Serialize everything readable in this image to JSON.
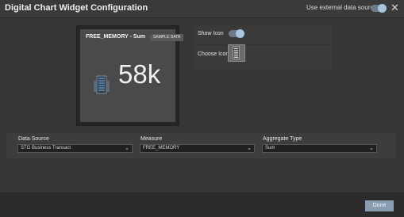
{
  "dialog": {
    "title": "Digital Chart Widget Configuration",
    "external_label": "Use external data sources"
  },
  "preview": {
    "title": "FREE_MEMORY - Sum",
    "badge": "SAMPLE DATA",
    "value": "58k"
  },
  "options": {
    "show_icon_label": "Show Icon",
    "choose_icon_label": "Choose Icon"
  },
  "fields": {
    "data_source": {
      "label": "Data Source",
      "value": "STG Business Transact"
    },
    "measure": {
      "label": "Measure",
      "value": "FREE_MEMORY"
    },
    "aggregate": {
      "label": "Aggregate Type",
      "value": "Sum"
    }
  },
  "footer": {
    "done_label": "Done"
  },
  "colors": {
    "accent": "#8a9cb0",
    "toggle_on": "#a8c4df",
    "icon_server": "#4a7aa6"
  },
  "icons": [
    "close-icon",
    "server-icon",
    "chevron-down-icon"
  ]
}
